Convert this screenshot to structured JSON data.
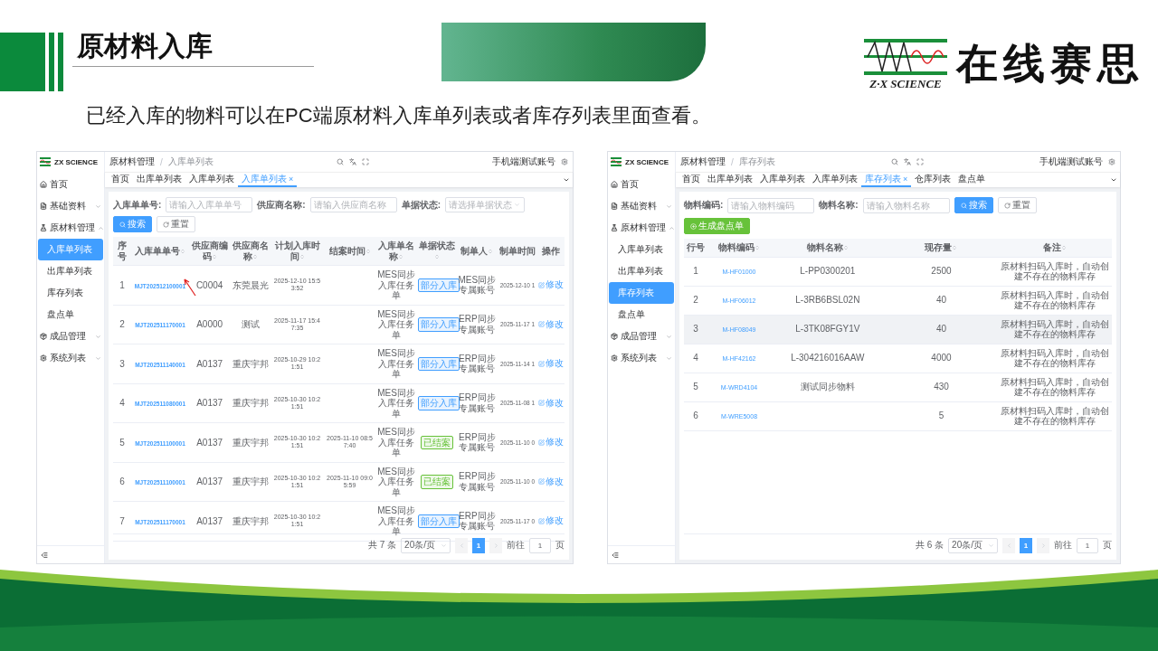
{
  "slide": {
    "title": "原材料入库",
    "logo": {
      "tagline": "Z·X SCIENCE",
      "name": "在线赛思"
    },
    "caption": "已经入库的物料可以在PC端原材料入库单列表或者库存列表里面查看。"
  },
  "screenshots": [
    {
      "brand": "ZX SCIENCE",
      "annotated": true,
      "nav": [
        {
          "label": "首页"
        },
        {
          "label": "基础资料",
          "expanded": false
        },
        {
          "label": "原材料管理",
          "expanded": true,
          "children": [
            {
              "label": "入库单列表",
              "selected": true
            },
            {
              "label": "出库单列表",
              "selected": false
            },
            {
              "label": "库存列表",
              "selected": false
            },
            {
              "label": "盘点单",
              "selected": false
            }
          ]
        },
        {
          "label": "成品管理",
          "expanded": false
        },
        {
          "label": "系统列表",
          "expanded": false
        }
      ],
      "breadcrumb": {
        "items": [
          "原材料管理",
          "入库单列表"
        ],
        "separator": "/"
      },
      "user": "手机端测试账号",
      "tabs": [
        {
          "label": "首页",
          "selected": false
        },
        {
          "label": "出库单列表",
          "selected": false
        },
        {
          "label": "入库单列表",
          "selected": false
        },
        {
          "label": "入库单列表",
          "selected": true,
          "close": "×"
        }
      ],
      "filters": [
        {
          "label": "入库单单号:",
          "placeholder": "请输入入库单单号",
          "kind": "text"
        },
        {
          "label": "供应商名称:",
          "placeholder": "请输入供应商名称",
          "kind": "text"
        },
        {
          "label": "单据状态:",
          "placeholder": "请选择单据状态",
          "kind": "select"
        }
      ],
      "buttons": [
        {
          "label": "搜索",
          "kind": "primary"
        },
        {
          "label": "重置",
          "kind": "default"
        }
      ],
      "table": {
        "columns": [
          {
            "label": "序号",
            "sortable": false,
            "kind": "index"
          },
          {
            "label": "入库单单号",
            "sortable": true,
            "kind": "order_link"
          },
          {
            "label": "供应商编码",
            "sortable": true,
            "kind": "text"
          },
          {
            "label": "供应商名称",
            "sortable": true,
            "kind": "text"
          },
          {
            "label": "计划入库时间",
            "sortable": true,
            "kind": "date"
          },
          {
            "label": "结案时间",
            "sortable": true,
            "kind": "date"
          },
          {
            "label": "入库单名称",
            "sortable": true,
            "kind": "text"
          },
          {
            "label": "单据状态",
            "sortable": true,
            "kind": "tag"
          },
          {
            "label": "制单人",
            "sortable": true,
            "kind": "text"
          },
          {
            "label": "制单时间",
            "sortable": false,
            "kind": "cut"
          },
          {
            "label": "操作",
            "sortable": false,
            "kind": "action"
          }
        ],
        "rows": [
          {
            "cells": [
              "1",
              "MJT202512100001",
              "C0004",
              "东莞晨光",
              "2025-12-10 15:53:52",
              null,
              "MES同步入库任务单",
              {
                "text": "部分入库",
                "color": "#409eff"
              },
              "MES同步专属账号",
              "2025-12-10 1",
              "修改"
            ]
          },
          {
            "cells": [
              "2",
              "MJT202511170001",
              "A0000",
              "测试",
              "2025-11-17 15:47:35",
              null,
              "MES同步入库任务单",
              {
                "text": "部分入库",
                "color": "#409eff"
              },
              "ERP同步专属账号",
              "2025-11-17 1",
              "修改"
            ]
          },
          {
            "cells": [
              "3",
              "MJT202511140001",
              "A0137",
              "重庆宇邦",
              "2025-10-29 10:21:51",
              null,
              "MES同步入库任务单",
              {
                "text": "部分入库",
                "color": "#409eff"
              },
              "ERP同步专属账号",
              "2025-11-14 1",
              "修改"
            ]
          },
          {
            "cells": [
              "4",
              "MJT202511080001",
              "A0137",
              "重庆宇邦",
              "2025-10-30 10:21:51",
              null,
              "MES同步入库任务单",
              {
                "text": "部分入库",
                "color": "#409eff"
              },
              "ERP同步专属账号",
              "2025-11-08 1",
              "修改"
            ]
          },
          {
            "cells": [
              "5",
              "MJT202511100001",
              "A0137",
              "重庆宇邦",
              "2025-10-30 10:21:51",
              "2025-11-10 08:57:40",
              "MES同步入库任务单",
              {
                "text": "已结案",
                "color": "#67c23a"
              },
              "ERP同步专属账号",
              "2025-11-10 0",
              "修改"
            ]
          },
          {
            "cells": [
              "6",
              "MJT202511100001",
              "A0137",
              "重庆宇邦",
              "2025-10-30 10:21:51",
              "2025-11-10 09:05:59",
              "MES同步入库任务单",
              {
                "text": "已结案",
                "color": "#67c23a"
              },
              "ERP同步专属账号",
              "2025-11-10 0",
              "修改"
            ]
          },
          {
            "cells": [
              "7",
              "MJT202511170001",
              "A0137",
              "重庆宇邦",
              "2025-10-30 10:21:51",
              null,
              "MES同步入库任务单",
              {
                "text": "部分入库",
                "color": "#409eff"
              },
              "ERP同步专属账号",
              "2025-11-17 0",
              "修改"
            ]
          }
        ]
      },
      "pagination": {
        "total": "共 7 条",
        "page_size": "20条/页",
        "pages": [
          {
            "label": "1",
            "selected": true
          }
        ],
        "goto_label": "前往",
        "goto_value": "1",
        "page_suffix": "页"
      }
    },
    {
      "brand": "ZX SCIENCE",
      "annotated": false,
      "nav": [
        {
          "label": "首页"
        },
        {
          "label": "基础资料",
          "expanded": false
        },
        {
          "label": "原材料管理",
          "expanded": true,
          "children": [
            {
              "label": "入库单列表",
              "selected": false
            },
            {
              "label": "出库单列表",
              "selected": false
            },
            {
              "label": "库存列表",
              "selected": true
            },
            {
              "label": "盘点单",
              "selected": false
            }
          ]
        },
        {
          "label": "成品管理",
          "expanded": false
        },
        {
          "label": "系统列表",
          "expanded": false
        }
      ],
      "breadcrumb": {
        "items": [
          "原材料管理",
          "库存列表"
        ],
        "separator": "/"
      },
      "user": "手机端测试账号",
      "tabs": [
        {
          "label": "首页",
          "selected": false
        },
        {
          "label": "出库单列表",
          "selected": false
        },
        {
          "label": "入库单列表",
          "selected": false
        },
        {
          "label": "入库单列表",
          "selected": false
        },
        {
          "label": "库存列表",
          "selected": true,
          "close": "×"
        },
        {
          "label": "仓库列表",
          "selected": false
        },
        {
          "label": "盘点单",
          "selected": false
        }
      ],
      "filters": [
        {
          "label": "物料编码:",
          "placeholder": "请输入物料编码",
          "kind": "text"
        },
        {
          "label": "物料名称:",
          "placeholder": "请输入物料名称",
          "kind": "text"
        }
      ],
      "buttons": [
        {
          "label": "搜索",
          "kind": "primary"
        },
        {
          "label": "重置",
          "kind": "default"
        }
      ],
      "actions": [
        {
          "label": "生成盘点单",
          "kind": "success"
        }
      ],
      "table": {
        "columns": [
          {
            "label": "行号",
            "sortable": false,
            "kind": "index"
          },
          {
            "label": "物料编码",
            "sortable": true,
            "kind": "link"
          },
          {
            "label": "物料名称",
            "sortable": true,
            "kind": "text"
          },
          {
            "label": "现存量",
            "sortable": true,
            "kind": "text"
          },
          {
            "label": "备注",
            "sortable": true,
            "kind": "text"
          }
        ],
        "rows": [
          {
            "highlighted": false,
            "cells": [
              "1",
              "M-HF01000",
              "L-PP0300201",
              "2500",
              "原材料扫码入库时，自动创建不存在的物料库存"
            ]
          },
          {
            "highlighted": false,
            "cells": [
              "2",
              "M-HF06012",
              "L-3RB6BSL02N",
              "40",
              "原材料扫码入库时，自动创建不存在的物料库存"
            ]
          },
          {
            "highlighted": true,
            "cells": [
              "3",
              "M-HF08049",
              "L-3TK08FGY1V",
              "40",
              "原材料扫码入库时，自动创建不存在的物料库存"
            ]
          },
          {
            "highlighted": false,
            "cells": [
              "4",
              "M-HF42162",
              "L-304216016AAW",
              "4000",
              "原材料扫码入库时，自动创建不存在的物料库存"
            ]
          },
          {
            "highlighted": false,
            "cells": [
              "5",
              "M-WRD4104",
              "测试同步物料",
              "430",
              "原材料扫码入库时，自动创建不存在的物料库存"
            ]
          },
          {
            "highlighted": false,
            "cells": [
              "6",
              "M-WRE5008",
              null,
              "5",
              "原材料扫码入库时，自动创建不存在的物料库存"
            ]
          }
        ]
      },
      "pagination": {
        "total": "共 6 条",
        "page_size": "20条/页",
        "pages": [
          {
            "label": "1",
            "selected": true
          }
        ],
        "goto_label": "前往",
        "goto_value": "1",
        "page_suffix": "页"
      }
    }
  ]
}
